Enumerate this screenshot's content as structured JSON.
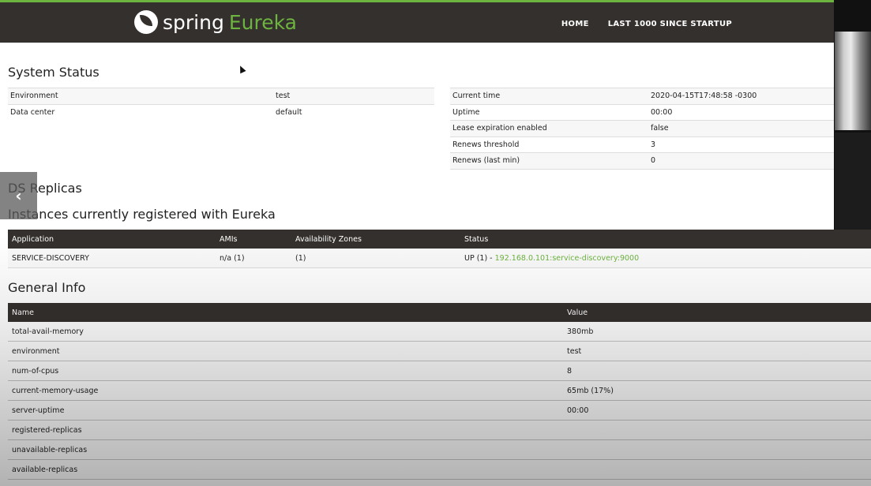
{
  "brand": {
    "name_part1": "spring",
    "name_part2": "Eureka"
  },
  "nav": {
    "home": "HOME",
    "last1000": "LAST 1000 SINCE STARTUP"
  },
  "system_status": {
    "title": "System Status",
    "left": [
      {
        "label": "Environment",
        "value": "test"
      },
      {
        "label": "Data center",
        "value": "default"
      }
    ],
    "right": [
      {
        "label": "Current time",
        "value": "2020-04-15T17:48:58 -0300"
      },
      {
        "label": "Uptime",
        "value": "00:00"
      },
      {
        "label": "Lease expiration enabled",
        "value": "false"
      },
      {
        "label": "Renews threshold",
        "value": "3"
      },
      {
        "label": "Renews (last min)",
        "value": "0"
      }
    ]
  },
  "ds_replicas": {
    "title": "DS Replicas"
  },
  "instances": {
    "title": "Instances currently registered with Eureka",
    "headers": [
      "Application",
      "AMIs",
      "Availability Zones",
      "Status"
    ],
    "rows": [
      {
        "application": "SERVICE-DISCOVERY",
        "amis": "n/a (1)",
        "zones": "(1)",
        "status_prefix": "UP (1) - ",
        "status_link": "192.168.0.101:service-discovery:9000"
      }
    ]
  },
  "general_info": {
    "title": "General Info",
    "headers": [
      "Name",
      "Value"
    ],
    "rows": [
      {
        "name": "total-avail-memory",
        "value": "380mb"
      },
      {
        "name": "environment",
        "value": "test"
      },
      {
        "name": "num-of-cpus",
        "value": "8"
      },
      {
        "name": "current-memory-usage",
        "value": "65mb (17%)"
      },
      {
        "name": "server-uptime",
        "value": "00:00"
      },
      {
        "name": "registered-replicas",
        "value": ""
      },
      {
        "name": "unavailable-replicas",
        "value": ""
      },
      {
        "name": "available-replicas",
        "value": ""
      }
    ]
  },
  "overlay": {
    "back_glyph": "‹"
  },
  "colors": {
    "accent": "#6db33f",
    "nav_bg": "#34302d"
  }
}
